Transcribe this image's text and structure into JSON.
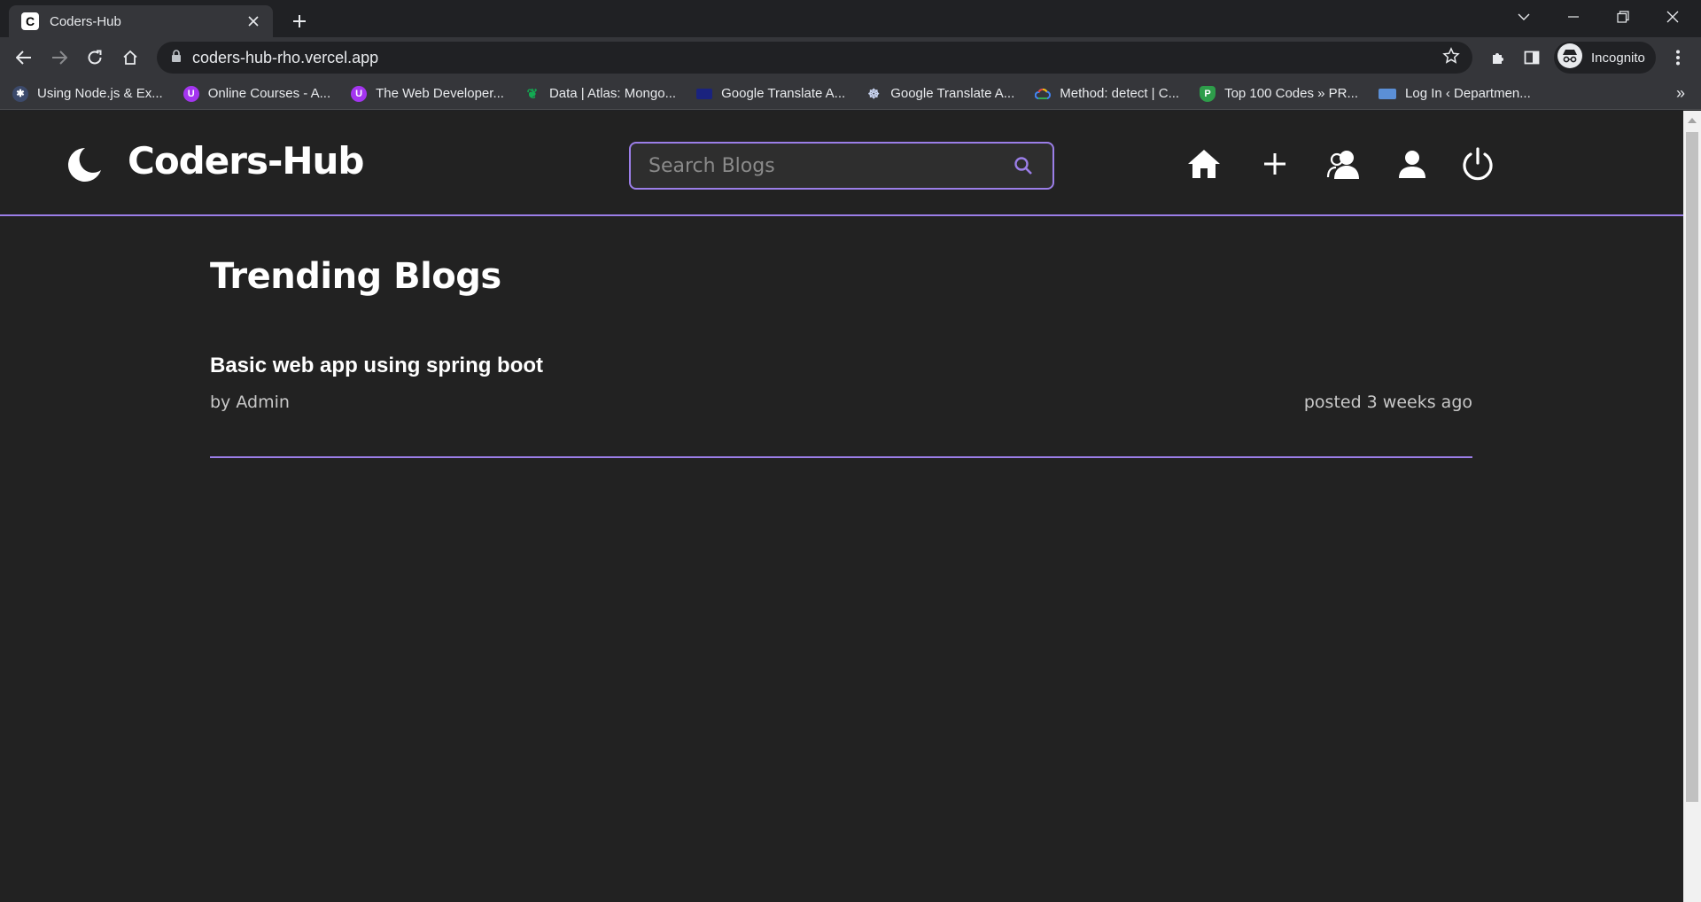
{
  "browser": {
    "tab_title": "Coders-Hub",
    "tab_favicon_letter": "C",
    "url": "coders-hub-rho.vercel.app",
    "profile_label": "Incognito",
    "bookmarks": [
      {
        "label": "Using Node.js & Ex...",
        "icon": "node-cluster-icon",
        "color": "#3c4a6b",
        "glyph": "✱"
      },
      {
        "label": "Online Courses - A...",
        "icon": "udemy-icon",
        "color": "#a435f0",
        "glyph": "U"
      },
      {
        "label": "The Web Developer...",
        "icon": "udemy-icon",
        "color": "#a435f0",
        "glyph": "U"
      },
      {
        "label": "Data | Atlas: Mongo...",
        "icon": "mongodb-leaf-icon",
        "color": "#13aa52",
        "glyph": "❦"
      },
      {
        "label": "Google Translate A...",
        "icon": "translate-doc-icon",
        "color": "#1a237e",
        "glyph": "▬"
      },
      {
        "label": "Google Translate A...",
        "icon": "rapidapi-icon",
        "color": "#0f1b3a",
        "glyph": "☸"
      },
      {
        "label": "Method: detect  |  C...",
        "icon": "google-cloud-icon",
        "color": "#4285f4",
        "glyph": "☁"
      },
      {
        "label": "Top 100 Codes » PR...",
        "icon": "shield-p-icon",
        "color": "#2e9d4a",
        "glyph": "P"
      },
      {
        "label": "Log In ‹ Departmen...",
        "icon": "department-logo-icon",
        "color": "#5b8fd6",
        "glyph": "▦"
      }
    ]
  },
  "site": {
    "logo_text": "Coders-Hub",
    "search_placeholder": "Search Blogs",
    "nav_icons": [
      "home-icon",
      "plus-icon",
      "users-icon",
      "user-icon",
      "power-icon"
    ]
  },
  "main": {
    "heading": "Trending Blogs",
    "blogs": [
      {
        "title": "Basic web app using spring boot",
        "author": "by Admin",
        "posted": "posted 3 weeks ago"
      }
    ]
  },
  "colors": {
    "accent": "#9b7ee8",
    "page_bg": "#222222",
    "browser_toolbar": "#35363a"
  }
}
